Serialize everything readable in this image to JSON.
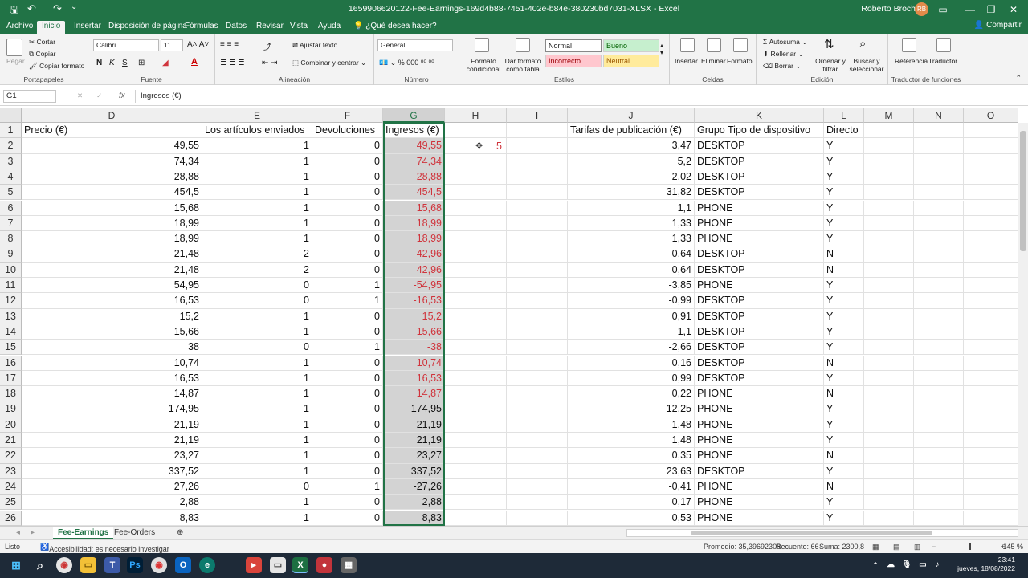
{
  "window": {
    "title": "1659906620122-Fee-Earnings-169d4b88-7451-402e-b84e-380230bd7031-XLSX  -  Excel",
    "user": "Roberto Broch",
    "avatar_initials": "RB"
  },
  "ribbon_tabs": [
    "Archivo",
    "Inicio",
    "Insertar",
    "Disposición de página",
    "Fórmulas",
    "Datos",
    "Revisar",
    "Vista",
    "Ayuda"
  ],
  "tell_me": "¿Qué desea hacer?",
  "share": "Compartir",
  "ribbon": {
    "portapapeles": {
      "paste": "Pegar",
      "cut": "Cortar",
      "copy": "Copiar",
      "format_painter": "Copiar formato",
      "label": "Portapapeles"
    },
    "fuente": {
      "font": "Calibri",
      "size": "11",
      "label": "Fuente"
    },
    "alineacion": {
      "wrap": "Ajustar texto",
      "merge": "Combinar y centrar",
      "label": "Alineación"
    },
    "numero": {
      "format": "General",
      "label": "Número"
    },
    "estilos": {
      "conditional": "Formato condicional",
      "as_table": "Dar formato como tabla",
      "normal": "Normal",
      "bueno": "Bueno",
      "incorrecto": "Incorrecto",
      "neutral": "Neutral",
      "label": "Estilos"
    },
    "celdas": {
      "insert": "Insertar",
      "delete": "Eliminar",
      "format": "Formato",
      "label": "Celdas"
    },
    "edicion": {
      "autosum": "Autosuma",
      "fill": "Rellenar",
      "clear": "Borrar",
      "sort": "Ordenar y filtrar",
      "find": "Buscar y seleccionar",
      "label": "Edición"
    },
    "traductor": {
      "ref": "Referencia",
      "translator": "Traductor",
      "label": "Traductor de funciones"
    }
  },
  "formula_bar": {
    "name_box": "G1",
    "fx": "fx",
    "content": "Ingresos (€)"
  },
  "columns": [
    "D",
    "E",
    "F",
    "G",
    "H",
    "I",
    "J",
    "K",
    "L",
    "M",
    "N",
    "O"
  ],
  "headers": {
    "D": "Precio (€)",
    "E": "Los artículos enviados",
    "F": "Devoluciones",
    "G": "Ingresos (€)",
    "J": "Tarifas de publicación (€)",
    "K": "Grupo Tipo de dispositivo",
    "L": "Directo"
  },
  "h2_value": "5",
  "rows": [
    {
      "n": "2",
      "D": "49,55",
      "E": "1",
      "F": "0",
      "G": "49,55",
      "J": "3,47",
      "K": "DESKTOP",
      "L": "Y"
    },
    {
      "n": "3",
      "D": "74,34",
      "E": "1",
      "F": "0",
      "G": "74,34",
      "J": "5,2",
      "K": "DESKTOP",
      "L": "Y"
    },
    {
      "n": "4",
      "D": "28,88",
      "E": "1",
      "F": "0",
      "G": "28,88",
      "J": "2,02",
      "K": "DESKTOP",
      "L": "Y"
    },
    {
      "n": "5",
      "D": "454,5",
      "E": "1",
      "F": "0",
      "G": "454,5",
      "J": "31,82",
      "K": "DESKTOP",
      "L": "Y"
    },
    {
      "n": "6",
      "D": "15,68",
      "E": "1",
      "F": "0",
      "G": "15,68",
      "J": "1,1",
      "K": "PHONE",
      "L": "Y"
    },
    {
      "n": "7",
      "D": "18,99",
      "E": "1",
      "F": "0",
      "G": "18,99",
      "J": "1,33",
      "K": "PHONE",
      "L": "Y"
    },
    {
      "n": "8",
      "D": "18,99",
      "E": "1",
      "F": "0",
      "G": "18,99",
      "J": "1,33",
      "K": "PHONE",
      "L": "Y"
    },
    {
      "n": "9",
      "D": "21,48",
      "E": "2",
      "F": "0",
      "G": "42,96",
      "J": "0,64",
      "K": "DESKTOP",
      "L": "N"
    },
    {
      "n": "10",
      "D": "21,48",
      "E": "2",
      "F": "0",
      "G": "42,96",
      "J": "0,64",
      "K": "DESKTOP",
      "L": "N"
    },
    {
      "n": "11",
      "D": "54,95",
      "E": "0",
      "F": "1",
      "G": "-54,95",
      "J": "-3,85",
      "K": "PHONE",
      "L": "Y"
    },
    {
      "n": "12",
      "D": "16,53",
      "E": "0",
      "F": "1",
      "G": "-16,53",
      "J": "-0,99",
      "K": "DESKTOP",
      "L": "Y"
    },
    {
      "n": "13",
      "D": "15,2",
      "E": "1",
      "F": "0",
      "G": "15,2",
      "J": "0,91",
      "K": "DESKTOP",
      "L": "Y"
    },
    {
      "n": "14",
      "D": "15,66",
      "E": "1",
      "F": "0",
      "G": "15,66",
      "J": "1,1",
      "K": "DESKTOP",
      "L": "Y"
    },
    {
      "n": "15",
      "D": "38",
      "E": "0",
      "F": "1",
      "G": "-38",
      "J": "-2,66",
      "K": "DESKTOP",
      "L": "Y"
    },
    {
      "n": "16",
      "D": "10,74",
      "E": "1",
      "F": "0",
      "G": "10,74",
      "J": "0,16",
      "K": "DESKTOP",
      "L": "N"
    },
    {
      "n": "17",
      "D": "16,53",
      "E": "1",
      "F": "0",
      "G": "16,53",
      "J": "0,99",
      "K": "DESKTOP",
      "L": "Y"
    },
    {
      "n": "18",
      "D": "14,87",
      "E": "1",
      "F": "0",
      "G": "14,87",
      "J": "0,22",
      "K": "PHONE",
      "L": "N"
    },
    {
      "n": "19",
      "D": "174,95",
      "E": "1",
      "F": "0",
      "G": "174,95",
      "J": "12,25",
      "K": "PHONE",
      "L": "Y"
    },
    {
      "n": "20",
      "D": "21,19",
      "E": "1",
      "F": "0",
      "G": "21,19",
      "J": "1,48",
      "K": "PHONE",
      "L": "Y"
    },
    {
      "n": "21",
      "D": "21,19",
      "E": "1",
      "F": "0",
      "G": "21,19",
      "J": "1,48",
      "K": "PHONE",
      "L": "Y"
    },
    {
      "n": "22",
      "D": "23,27",
      "E": "1",
      "F": "0",
      "G": "23,27",
      "J": "0,35",
      "K": "PHONE",
      "L": "N"
    },
    {
      "n": "23",
      "D": "337,52",
      "E": "1",
      "F": "0",
      "G": "337,52",
      "J": "23,63",
      "K": "DESKTOP",
      "L": "Y"
    },
    {
      "n": "24",
      "D": "27,26",
      "E": "0",
      "F": "1",
      "G": "-27,26",
      "J": "-0,41",
      "K": "PHONE",
      "L": "N"
    },
    {
      "n": "25",
      "D": "2,88",
      "E": "1",
      "F": "0",
      "G": "2,88",
      "J": "0,17",
      "K": "PHONE",
      "L": "Y"
    },
    {
      "n": "26",
      "D": "8,83",
      "E": "1",
      "F": "0",
      "G": "8,83",
      "J": "0,53",
      "K": "PHONE",
      "L": "Y"
    }
  ],
  "red_rows_g": [
    "2",
    "3",
    "4",
    "5",
    "6",
    "7",
    "8",
    "9",
    "10",
    "11",
    "12",
    "13",
    "14",
    "15",
    "16",
    "17",
    "18"
  ],
  "sheet_tabs": [
    "Fee-Earnings",
    "Fee-Orders"
  ],
  "status": {
    "ready": "Listo",
    "accessibility": "Accesibilidad: es necesario investigar",
    "average": "Promedio: 35,39692308",
    "count": "Recuento: 66",
    "sum": "Suma: 2300,8",
    "zoom": "145 %"
  },
  "clock": {
    "time": "23:41",
    "date": "jueves, 18/08/2022"
  },
  "colors": {
    "excel_green": "#217346",
    "red_text": "#d0343c",
    "selection_gray": "#d3d3d3",
    "bueno_bg": "#c6efce",
    "incorrecto_bg": "#ffc7ce",
    "neutral_bg": "#ffeb9c"
  }
}
